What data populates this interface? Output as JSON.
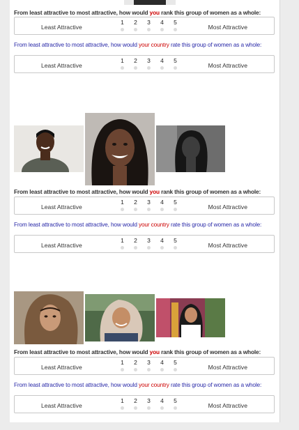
{
  "question_you": {
    "prefix": "From least attractive to most attractive, how would ",
    "highlight": "you",
    "suffix": " rank this group of women as a whole:"
  },
  "question_country": {
    "prefix": "From least attractive to most attractive, how would ",
    "highlight": "your country",
    "suffix": " rate this group of women as a whole:"
  },
  "scale": {
    "numbers": [
      "1",
      "2",
      "3",
      "4",
      "5"
    ],
    "least_label": "Least Attractive",
    "most_label": "Most Attractive"
  },
  "colors": {
    "highlight": "#cc0000",
    "country_question": "#2929a8",
    "radio": "#dcdcdc"
  }
}
